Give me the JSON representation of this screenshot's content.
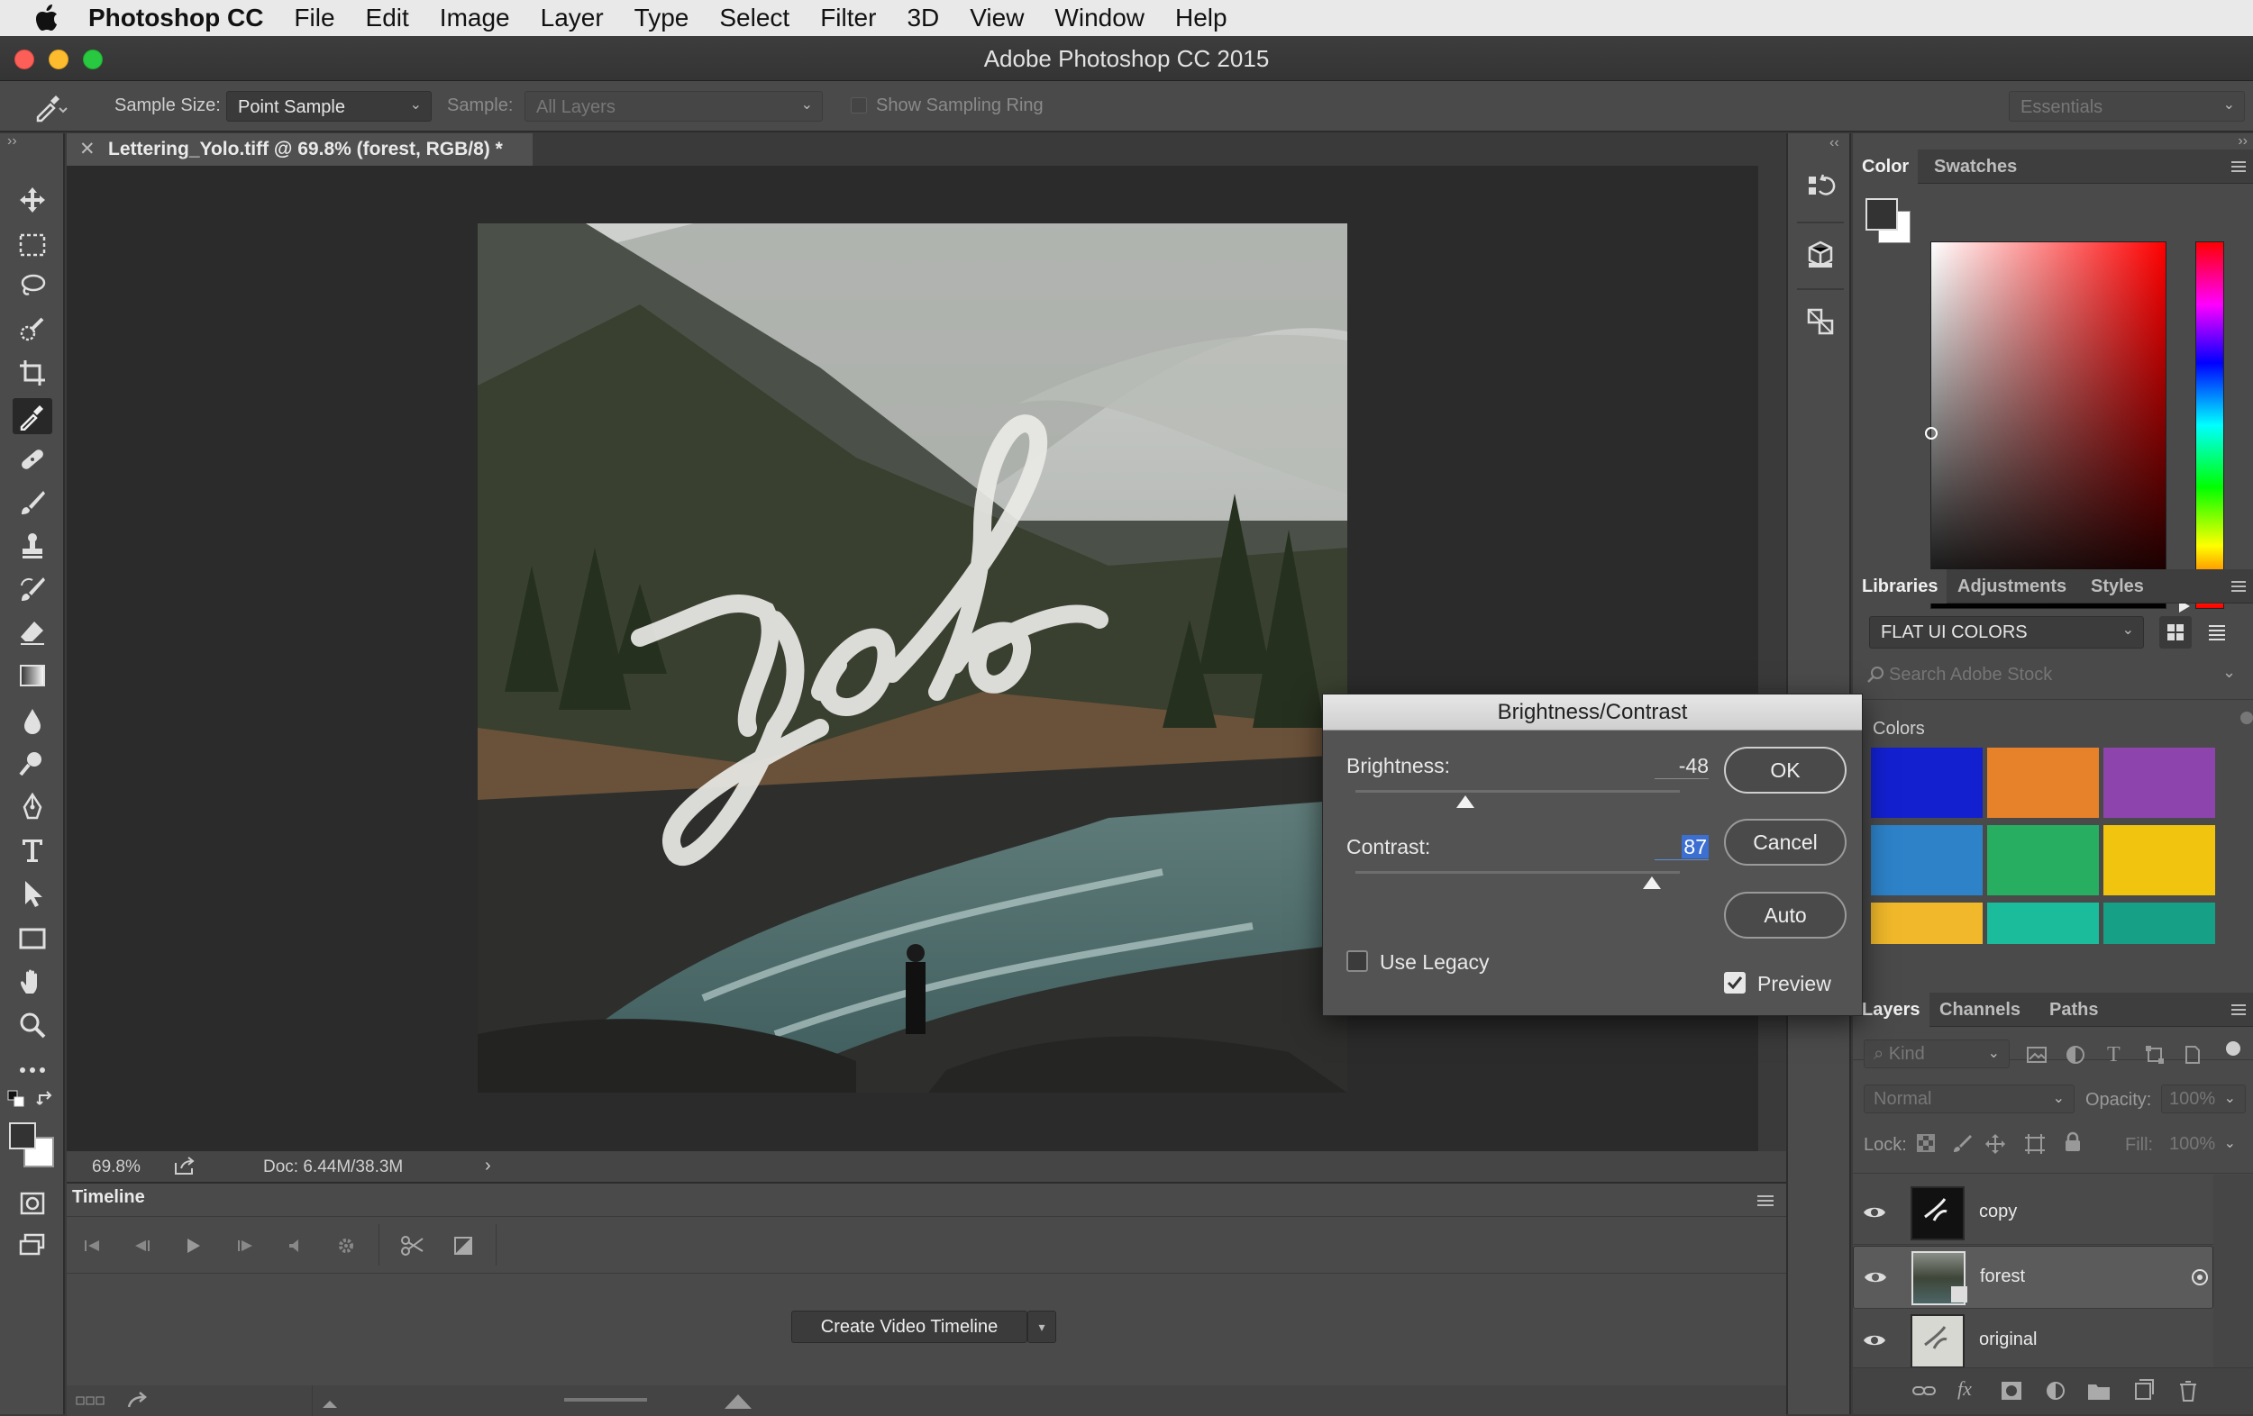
{
  "menubar": {
    "app": "Photoshop CC",
    "items": [
      "File",
      "Edit",
      "Image",
      "Layer",
      "Type",
      "Select",
      "Filter",
      "3D",
      "View",
      "Window",
      "Help"
    ]
  },
  "window": {
    "title": "Adobe Photoshop CC 2015"
  },
  "options": {
    "sample_size_label": "Sample Size:",
    "sample_size_value": "Point Sample",
    "sample_label": "Sample:",
    "sample_value": "All Layers",
    "show_ring_label": "Show Sampling Ring",
    "workspace": "Essentials"
  },
  "document": {
    "tab_title": "Lettering_Yolo.tiff @ 69.8% (forest, RGB/8) *",
    "zoom": "69.8%",
    "doc_size": "Doc: 6.44M/38.3M"
  },
  "timeline": {
    "tab": "Timeline",
    "create_button": "Create Video Timeline"
  },
  "color_panel": {
    "tabs": [
      "Color",
      "Swatches"
    ],
    "foreground": "#333333",
    "background": "#ffffff"
  },
  "libraries_panel": {
    "tabs": [
      "Libraries",
      "Adjustments",
      "Styles"
    ],
    "library": "FLAT UI COLORS",
    "search_placeholder": "Search Adobe Stock",
    "section": "Colors",
    "swatches": [
      "#1320d0",
      "#e8822a",
      "#8e44ad",
      "#2d82c8",
      "#27ae60",
      "#f1c40f",
      "#f0b82a",
      "#1abc9c",
      "#16a085"
    ]
  },
  "layers_panel": {
    "tabs": [
      "Layers",
      "Channels",
      "Paths"
    ],
    "filter": "Kind",
    "blend_mode": "Normal",
    "opacity_label": "Opacity:",
    "opacity_value": "100%",
    "lock_label": "Lock:",
    "fill_label": "Fill:",
    "fill_value": "100%",
    "layers": [
      {
        "name": "copy"
      },
      {
        "name": "forest"
      },
      {
        "name": "original"
      }
    ]
  },
  "dialog": {
    "title": "Brightness/Contrast",
    "brightness_label": "Brightness:",
    "brightness_value": "-48",
    "brightness_level": -48,
    "contrast_label": "Contrast:",
    "contrast_value": "87",
    "contrast_level": 87,
    "ok": "OK",
    "cancel": "Cancel",
    "auto": "Auto",
    "use_legacy": "Use Legacy",
    "preview": "Preview"
  }
}
